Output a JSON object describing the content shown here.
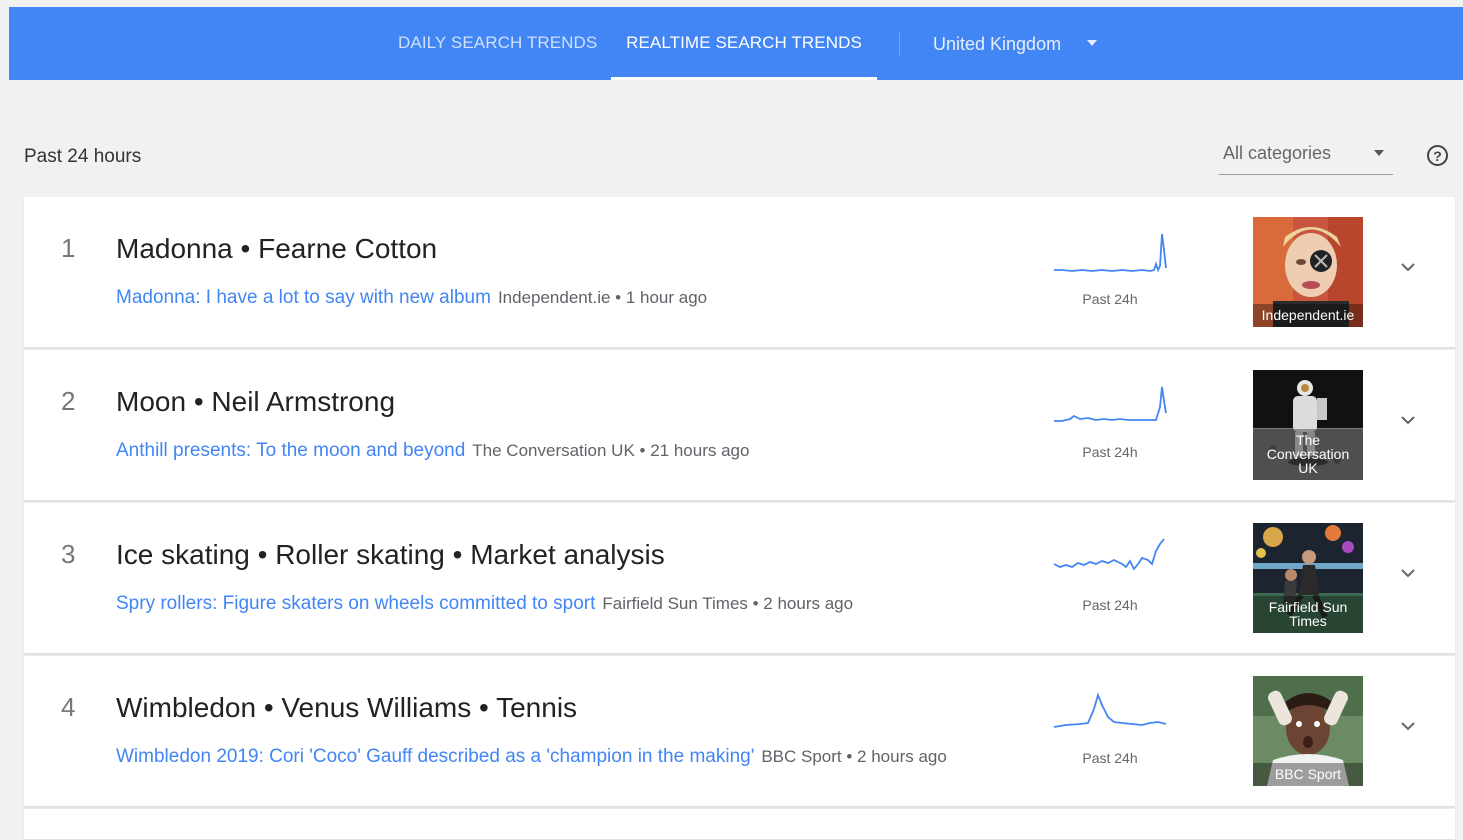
{
  "nav": {
    "daily_tab": "DAILY SEARCH TRENDS",
    "realtime_tab": "REALTIME SEARCH TRENDS",
    "country": "United Kingdom"
  },
  "filters": {
    "period": "Past 24 hours",
    "category": "All categories",
    "help": "?"
  },
  "colors": {
    "brand": "#4285f4",
    "link": "#4285f4"
  },
  "trends": [
    {
      "rank": "1",
      "title": "Madonna • Fearne Cotton",
      "story_title": "Madonna: I have a lot to say with new album",
      "story_meta": "Independent.ie • 1 hour ago",
      "spark_label": "Past 24h",
      "thumb_caption": "Independent.ie"
    },
    {
      "rank": "2",
      "title": "Moon • Neil Armstrong",
      "story_title": "Anthill presents: To the moon and beyond",
      "story_meta": "The Conversation UK • 21 hours ago",
      "spark_label": "Past 24h",
      "thumb_caption": "The Conversation UK"
    },
    {
      "rank": "3",
      "title": "Ice skating • Roller skating • Market analysis",
      "story_title": "Spry rollers: Figure skaters on wheels committed to sport",
      "story_meta": "Fairfield Sun Times • 2 hours ago",
      "spark_label": "Past 24h",
      "thumb_caption": "Fairfield Sun Times"
    },
    {
      "rank": "4",
      "title": "Wimbledon • Venus Williams • Tennis",
      "story_title": "Wimbledon 2019: Cori 'Coco' Gauff described as a 'champion in the making'",
      "story_meta": "BBC Sport • 2 hours ago",
      "spark_label": "Past 24h",
      "thumb_caption": "BBC Sport"
    }
  ]
}
